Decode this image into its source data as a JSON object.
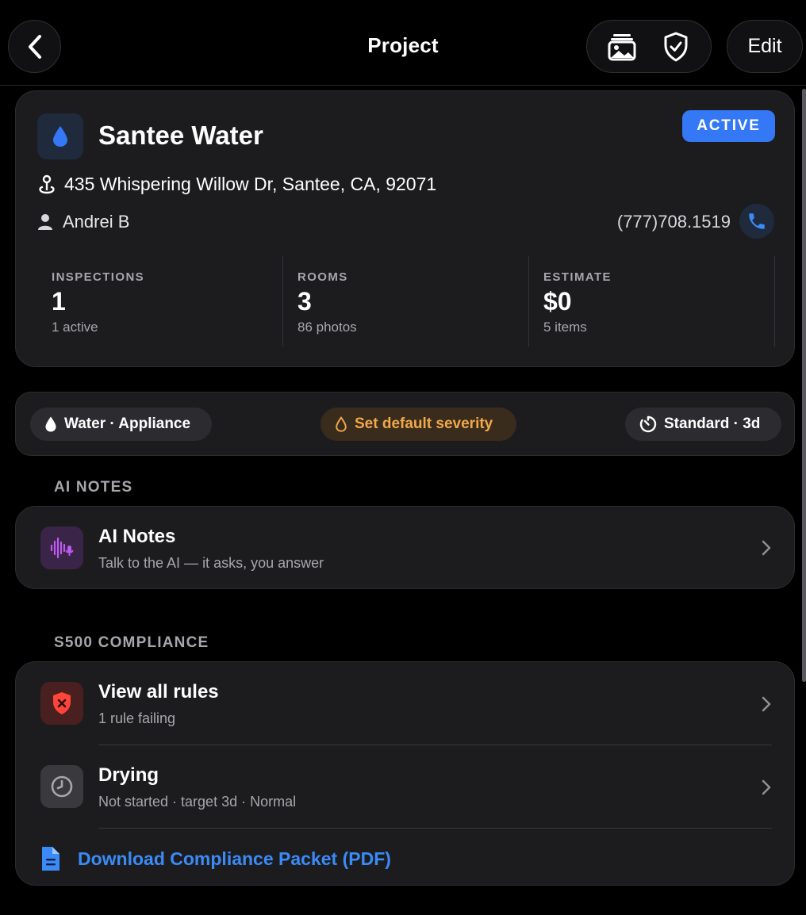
{
  "header": {
    "title": "Project",
    "edit_label": "Edit"
  },
  "project": {
    "name": "Santee Water",
    "status": "ACTIVE",
    "address": "435 Whispering Willow Dr, Santee, CA, 92071",
    "contact_name": "Andrei B",
    "phone": "(777)708.1519",
    "stats": [
      {
        "label": "INSPECTIONS",
        "value": "1",
        "sub": "1 active"
      },
      {
        "label": "ROOMS",
        "value": "3",
        "sub": "86 photos"
      },
      {
        "label": "ESTIMATE",
        "value": "$0",
        "sub": "5 items"
      }
    ]
  },
  "tags": {
    "loss_type": "Water · Appliance",
    "severity": "Set default severity",
    "drying": "Standard · 3d"
  },
  "ai_notes": {
    "section": "AI NOTES",
    "title": "AI Notes",
    "subtitle": "Talk to the AI — it asks, you answer"
  },
  "compliance": {
    "section": "S500 COMPLIANCE",
    "rules_title": "View all rules",
    "rules_sub": "1 rule failing",
    "drying_title": "Drying",
    "drying_sub": "Not started · target 3d · Normal",
    "pdf_link": "Download Compliance Packet (PDF)"
  },
  "colors": {
    "accent_blue": "#3478f6",
    "severity_orange": "#f0a84a",
    "danger_red": "#ff453a",
    "ai_purple": "#bf5af2"
  },
  "icons": [
    "back-chevron-icon",
    "photo-gallery-icon",
    "shield-check-icon",
    "water-drop-icon",
    "location-pin-icon",
    "person-icon",
    "phone-icon",
    "timer-icon",
    "microphone-waveform-icon",
    "shield-x-icon",
    "clock-icon",
    "document-icon",
    "chevron-right-icon"
  ]
}
